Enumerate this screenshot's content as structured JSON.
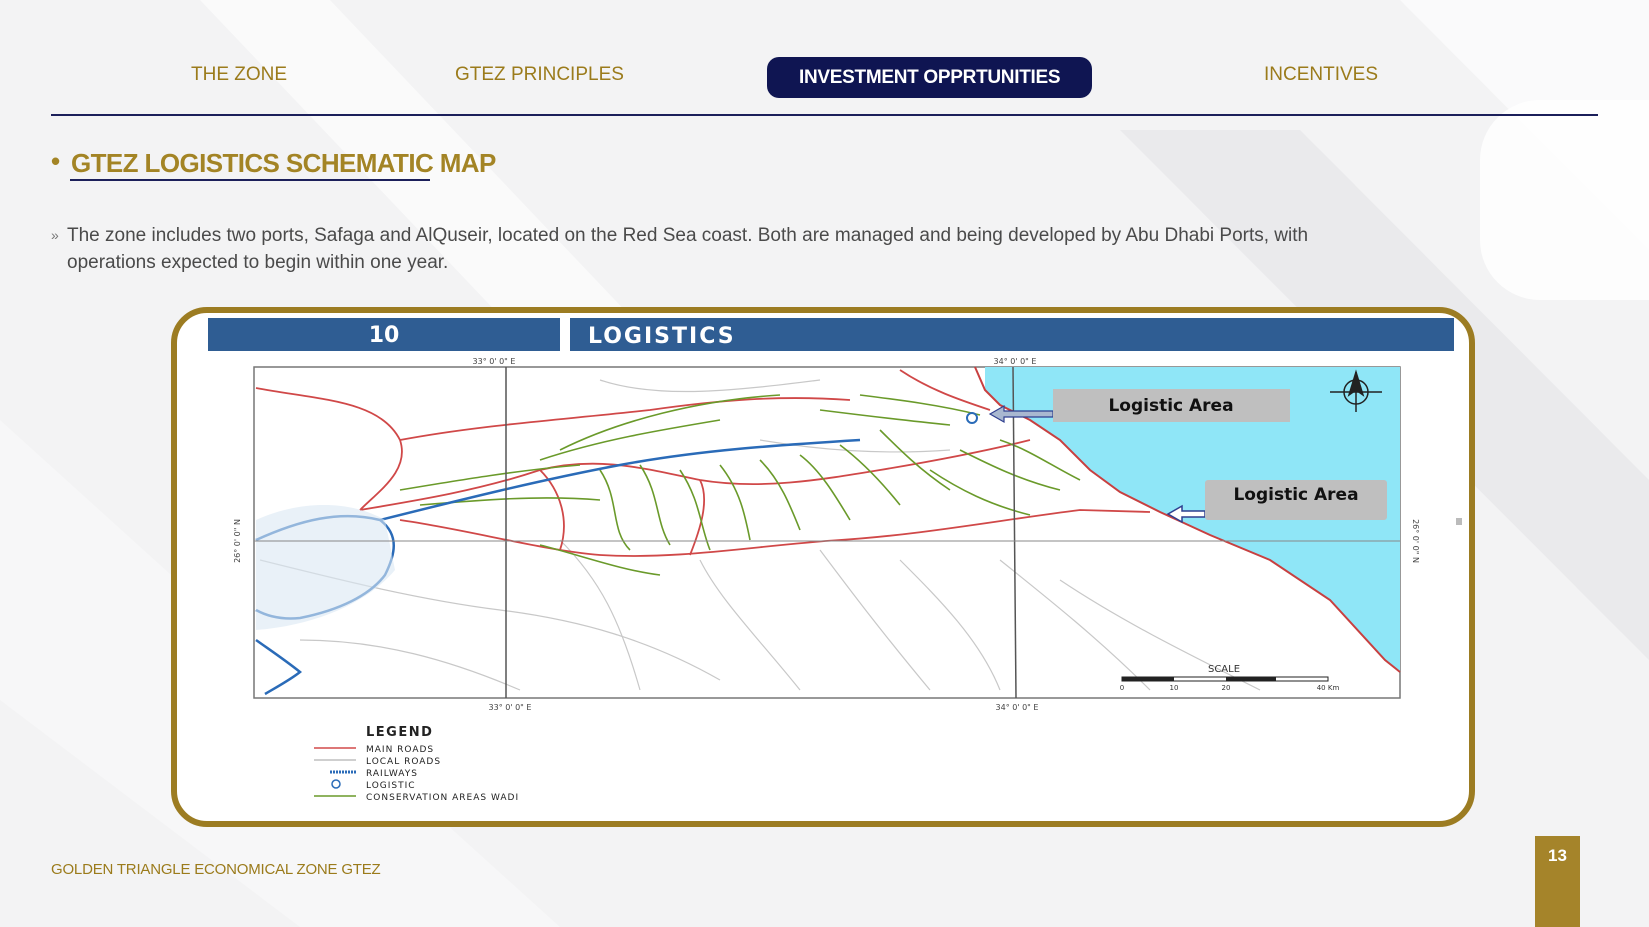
{
  "nav": {
    "items": [
      "THE ZONE",
      "GTEZ PRINCIPLES",
      "INVESTMENT OPPRTUNITIES",
      "INCENTIVES"
    ],
    "active_index": 2
  },
  "heading": {
    "title": "GTEZ LOGISTICS SCHEMATIC MAP"
  },
  "description": {
    "marker": "»",
    "text": "The zone includes two ports, Safaga and AlQuseir, located on the Red Sea coast. Both are managed and being developed by Abu Dhabi Ports, with operations expected to begin within one year."
  },
  "map": {
    "section_number": "10",
    "section_title": "LOGISTICS",
    "grid_labels": {
      "top_left": "33° 0' 0\" E",
      "top_right": "34° 0' 0\" E",
      "bottom_left": "33° 0' 0\" E",
      "bottom_right": "34° 0' 0\" E",
      "left": "26° 0' 0\" N",
      "right": "26° 0' 0\" N"
    },
    "callouts": [
      "Logistic Area",
      "Logistic Area"
    ],
    "scale": {
      "title": "SCALE",
      "ticks": [
        "0",
        "10",
        "20",
        "40 Km"
      ]
    },
    "legend": {
      "title": "LEGEND",
      "items": [
        {
          "label": "MAIN ROADS",
          "color": "#d24a4a"
        },
        {
          "label": "LOCAL ROADS",
          "color": "#bfbfbf"
        },
        {
          "label": "RAILWAYS",
          "color": "#2a6bb8"
        },
        {
          "label": "LOGISTIC",
          "color": "#2a6bb8"
        },
        {
          "label": "CONSERVATION AREAS WADI",
          "color": "#6a9a2a"
        }
      ]
    },
    "colors": {
      "sea": "#8fe6f7",
      "header_bar": "#2f5d93",
      "frame": "#9c7c22"
    }
  },
  "footer": {
    "text": "GOLDEN TRIANGLE ECONOMICAL ZONE GTEZ",
    "page_number": "13"
  },
  "colors": {
    "gold": "#a38425",
    "navy": "#0f1552"
  }
}
